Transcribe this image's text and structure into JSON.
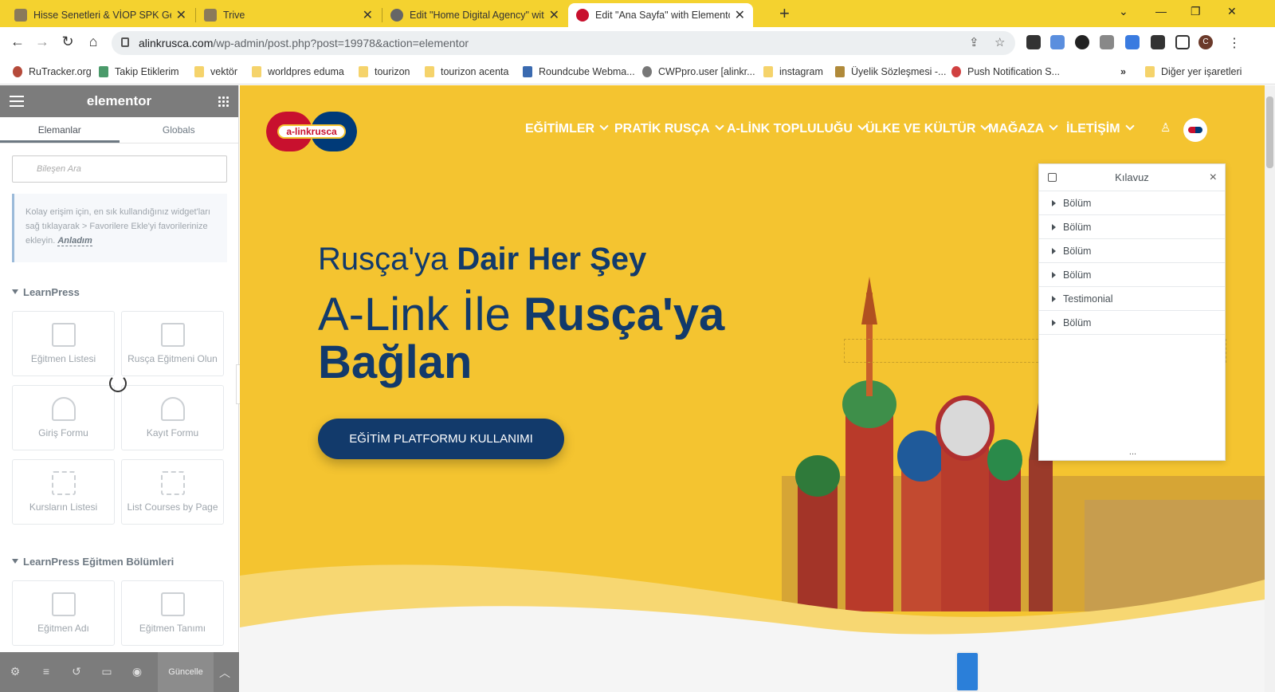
{
  "browser": {
    "tabs": [
      {
        "title": "Hisse Senetleri & VİOP SPK Geniş",
        "fav_color": "#7a6a4a"
      },
      {
        "title": "Trive",
        "fav_color": "#7a6a4a"
      },
      {
        "title": "Edit \"Home Digital Agency\" with",
        "fav_color": "#555"
      },
      {
        "title": "Edit \"Ana Sayfa\" with Elementor",
        "fav_color": "#c8102e"
      }
    ],
    "url_host": "alinkrusca.com",
    "url_path": "/wp-admin/post.php?post=19978&action=elementor",
    "bookmarks": [
      "RuTracker.org",
      "Takip Etiklerim",
      "vektör",
      "worldpres eduma",
      "tourizon",
      "tourizon acenta",
      "Roundcube Webma...",
      "CWPpro.user [alinkr...",
      "instagram",
      "Üyelik Sözleşmesi -...",
      "Push Notification S..."
    ],
    "bookmarks_overflow": "»",
    "other_bookmarks": "Diğer yer işaretleri",
    "profile_initial": "C"
  },
  "elementor": {
    "brand": "elementor",
    "tabs": [
      "Elemanlar",
      "Globals"
    ],
    "search_placeholder": "Bileşen Ara",
    "hint_text": "Kolay erişim için, en sık kullandığınız widget'ları sağ tıklayarak > Favorilere Ekle'yi favorilerinize ekleyin.",
    "hint_link": "Anladım",
    "categories": [
      {
        "name": "LearnPress",
        "widgets": [
          "Eğitmen Listesi",
          "Rusça Eğitmeni Olun",
          "Giriş Formu",
          "Kayıt Formu",
          "Kursların Listesi",
          "List Courses by Page"
        ]
      },
      {
        "name": "LearnPress Eğitmen Bölümleri",
        "widgets": [
          "Eğitmen Adı",
          "Eğitmen Tanımı"
        ]
      }
    ],
    "update_label": "Güncelle"
  },
  "site": {
    "logo_text": "a-linkrusca",
    "menu": [
      "EĞİTİMLER",
      "PRATİK RUSÇA",
      "A-LİNK TOPLULUĞU",
      "ÜLKE VE KÜLTÜR",
      "MAĞAZA",
      "İLETİŞİM"
    ],
    "headline_small_a": "Rusça'ya ",
    "headline_small_b": "Dair Her Şey",
    "headline_big_a": "A-Link İle ",
    "headline_big_b": "Rusça'ya Bağlan",
    "cta": "EĞİTİM PLATFORMU KULLANIMI",
    "colors": {
      "background": "#f4c430",
      "navy": "#123a6b",
      "red": "#c8102e"
    }
  },
  "navigator": {
    "title": "Kılavuz",
    "items": [
      "Bölüm",
      "Bölüm",
      "Bölüm",
      "Bölüm",
      "Testimonial",
      "Bölüm"
    ],
    "footer": "..."
  }
}
